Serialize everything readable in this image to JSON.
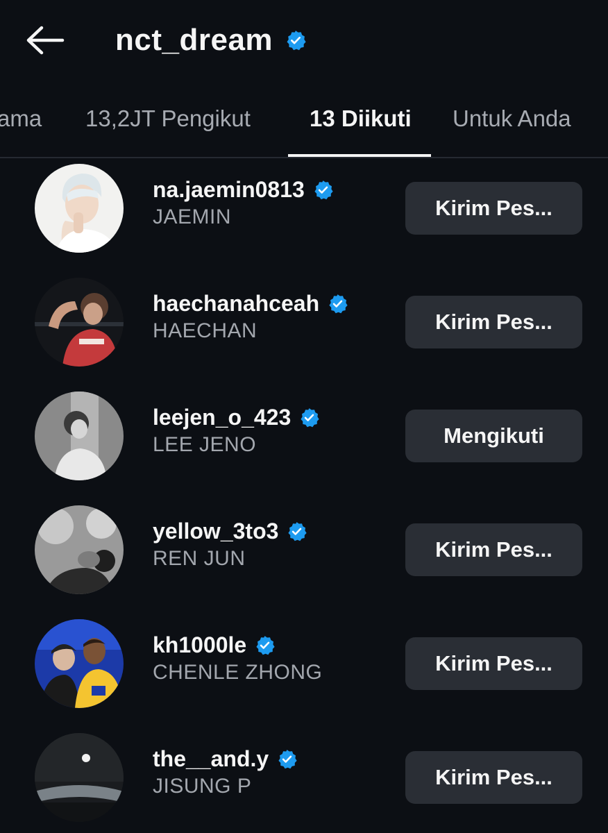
{
  "header": {
    "title": "nct_dream",
    "verified_icon": "verified-badge-icon",
    "back_icon": "back-arrow-icon"
  },
  "tabs": [
    {
      "label": "ama"
    },
    {
      "label": "13,2JT Pengikut"
    },
    {
      "label": "13 Diikuti",
      "active": true
    },
    {
      "label": "Untuk Anda"
    }
  ],
  "users": [
    {
      "username": "na.jaemin0813",
      "name": "JAEMIN",
      "button": "Kirim Pes...",
      "verified": true
    },
    {
      "username": "haechanahceah",
      "name": "HAECHAN",
      "button": "Kirim Pes...",
      "verified": true
    },
    {
      "username": "leejen_o_423",
      "name": "LEE JENO",
      "button": "Mengikuti",
      "verified": true
    },
    {
      "username": "yellow_3to3",
      "name": "REN JUN",
      "button": "Kirim Pes...",
      "verified": true
    },
    {
      "username": "kh1000le",
      "name": "CHENLE ZHONG",
      "button": "Kirim Pes...",
      "verified": true
    },
    {
      "username": "the__and.y",
      "name": "JISUNG P",
      "button": "Kirim Pes...",
      "verified": true
    }
  ],
  "colors": {
    "background": "#0c0f14",
    "verified": "#1d9bf0",
    "button": "#2a2e35",
    "secondary_text": "#a3a7ae"
  }
}
